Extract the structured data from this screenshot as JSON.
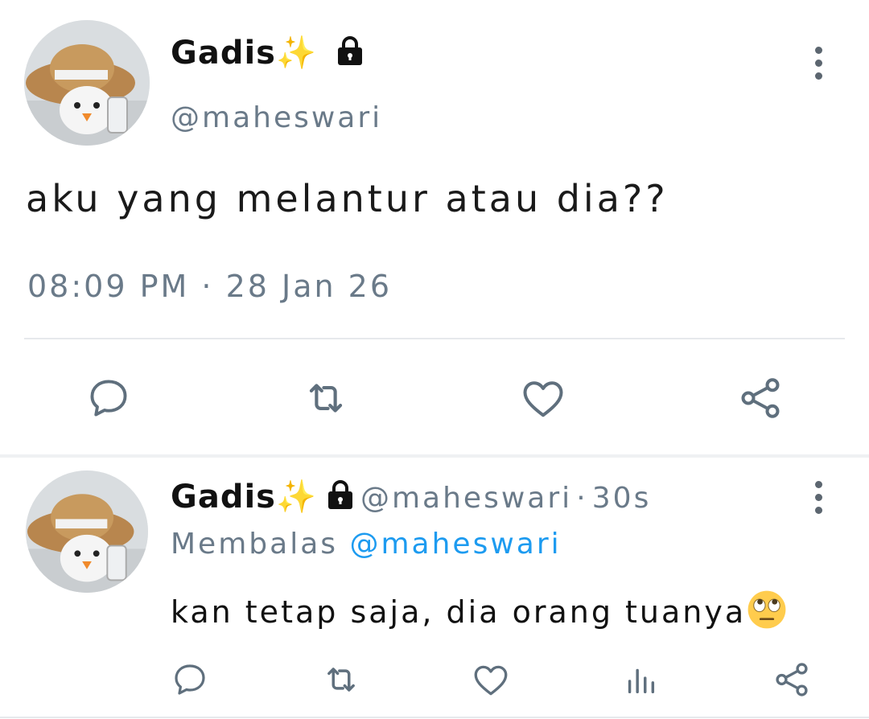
{
  "main_tweet": {
    "display_name": "Gadis",
    "sparkle_emoji": "✨",
    "handle": "@maheswari",
    "text": "aku yang melantur atau dia??",
    "time": "08:09 PM",
    "date_separator": "·",
    "date": "28 Jan 26"
  },
  "reply_tweet": {
    "display_name": "Gadis",
    "sparkle_emoji": "✨",
    "handle": "@maheswari",
    "time_separator": "·",
    "age": "30s",
    "replying_prefix": "Membalas",
    "replying_to": "@maheswari",
    "text": "kan tetap saja, dia orang tuanya"
  },
  "icons": {
    "lock": "lock-icon",
    "more": "more-vertical-icon",
    "reply": "comment-icon",
    "retweet": "retweet-icon",
    "like": "heart-icon",
    "share": "share-icon",
    "analytics": "bar-chart-icon",
    "eye_roll": "face-with-rolling-eyes-emoji"
  },
  "colors": {
    "text": "#111111",
    "muted": "#6a7a89",
    "link": "#1d9bf0",
    "icon": "#5f6f7d"
  }
}
